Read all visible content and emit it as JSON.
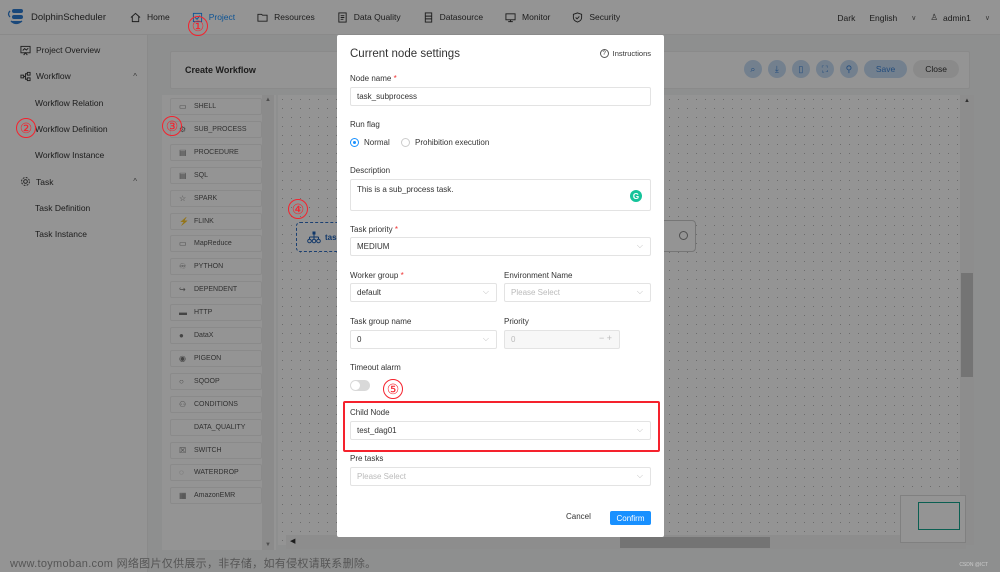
{
  "app": {
    "name": "DolphinScheduler"
  },
  "nav": {
    "items": [
      {
        "label": "Home",
        "icon": "home-icon"
      },
      {
        "label": "Project",
        "icon": "project-icon",
        "active": true
      },
      {
        "label": "Resources",
        "icon": "folder-icon"
      },
      {
        "label": "Data Quality",
        "icon": "data-quality-icon"
      },
      {
        "label": "Datasource",
        "icon": "datasource-icon"
      },
      {
        "label": "Monitor",
        "icon": "monitor-icon"
      },
      {
        "label": "Security",
        "icon": "shield-icon"
      }
    ],
    "theme": "Dark",
    "language": "English",
    "user": "admin1"
  },
  "sidebar": {
    "items": [
      {
        "label": "Project Overview",
        "icon": "overview-icon"
      },
      {
        "label": "Workflow",
        "icon": "workflow-icon",
        "expanded": true
      },
      {
        "label": "Workflow Relation"
      },
      {
        "label": "Workflow Definition"
      },
      {
        "label": "Workflow Instance"
      },
      {
        "label": "Task",
        "icon": "gear-icon",
        "expanded": true
      },
      {
        "label": "Task Definition"
      },
      {
        "label": "Task Instance"
      }
    ]
  },
  "workflow": {
    "title": "Create Workflow",
    "toolbar": {
      "save": "Save",
      "close": "Close"
    },
    "palette": [
      "SHELL",
      "SUB_PROCESS",
      "PROCEDURE",
      "SQL",
      "SPARK",
      "FLINK",
      "MapReduce",
      "PYTHON",
      "DEPENDENT",
      "HTTP",
      "DataX",
      "PIGEON",
      "SQOOP",
      "CONDITIONS",
      "DATA_QUALITY",
      "SWITCH",
      "WATERDROP",
      "AmazonEMR"
    ],
    "node_label": "tas"
  },
  "modal": {
    "title": "Current node settings",
    "instructions": "Instructions",
    "node_name": {
      "label": "Node name",
      "value": "task_subprocess"
    },
    "run_flag": {
      "label": "Run flag",
      "options": [
        "Normal",
        "Prohibition execution"
      ],
      "selected": "Normal"
    },
    "description": {
      "label": "Description",
      "value": "This is a sub_process task."
    },
    "task_priority": {
      "label": "Task priority",
      "value": "MEDIUM"
    },
    "worker_group": {
      "label": "Worker group",
      "value": "default"
    },
    "environment": {
      "label": "Environment Name",
      "placeholder": "Please Select"
    },
    "task_group": {
      "label": "Task group name",
      "value": "0"
    },
    "priority": {
      "label": "Priority",
      "value": "0"
    },
    "timeout_alarm": {
      "label": "Timeout alarm",
      "enabled": false
    },
    "child_node": {
      "label": "Child Node",
      "value": "test_dag01"
    },
    "pre_tasks": {
      "label": "Pre tasks",
      "placeholder": "Please Select"
    },
    "cancel": "Cancel",
    "confirm": "Confirm"
  },
  "annotations": [
    "①",
    "②",
    "③",
    "④",
    "⑤"
  ],
  "watermark": "www.toymoban.com 网络图片仅供展示，非存储，如有侵权请联系删除。",
  "corner_mark": "CSDN @ICT"
}
